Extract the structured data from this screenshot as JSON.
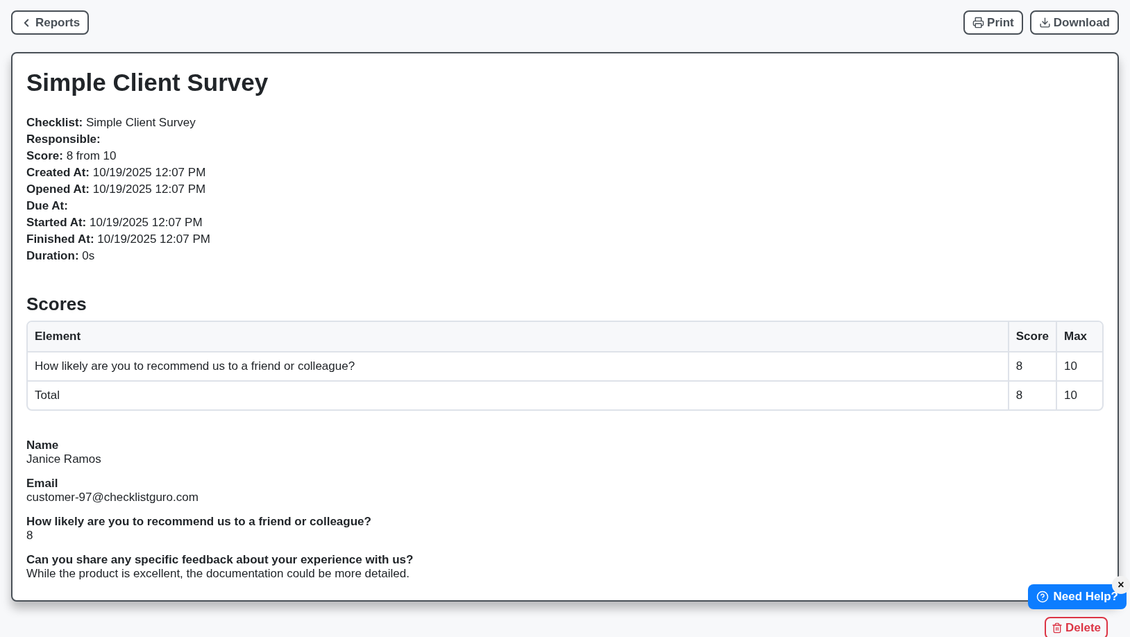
{
  "toolbar": {
    "back": "Reports",
    "print": "Print",
    "download": "Download"
  },
  "report": {
    "title": "Simple Client Survey",
    "fields": [
      {
        "label": "Checklist:",
        "value": "Simple Client Survey"
      },
      {
        "label": "Responsible:"
      },
      {
        "label": "Score:",
        "value": "8 from 10"
      },
      {
        "label": "Created At:",
        "value": "10/19/2025 12:07 PM"
      },
      {
        "label": "Opened At:",
        "value": "10/19/2025 12:07 PM"
      },
      {
        "label": "Due At:"
      },
      {
        "label": "Started At:",
        "value": "10/19/2025 12:07 PM"
      },
      {
        "label": "Finished At:",
        "value": "10/19/2025 12:07 PM"
      },
      {
        "label": "Duration:",
        "value": "0s"
      }
    ]
  },
  "scores": {
    "heading": "Scores",
    "columns": [
      "Element",
      "Score",
      "Max"
    ],
    "rows": [
      [
        "How likely are you to recommend us to a friend or colleague?",
        "8",
        "10"
      ],
      [
        "Total",
        "8",
        "10"
      ]
    ]
  },
  "answers": [
    {
      "question": "Name",
      "answer": "Janice Ramos"
    },
    {
      "question": "Email",
      "answer": "customer-97@checklistguro.com"
    },
    {
      "question": "How likely are you to recommend us to a friend or colleague?",
      "answer": "8"
    },
    {
      "question": "Can you share any specific feedback about your experience with us?",
      "answer": "While the product is excellent, the documentation could be more detailed."
    }
  ],
  "delete": "Delete",
  "help": {
    "label": "Need Help?",
    "close": "×"
  }
}
